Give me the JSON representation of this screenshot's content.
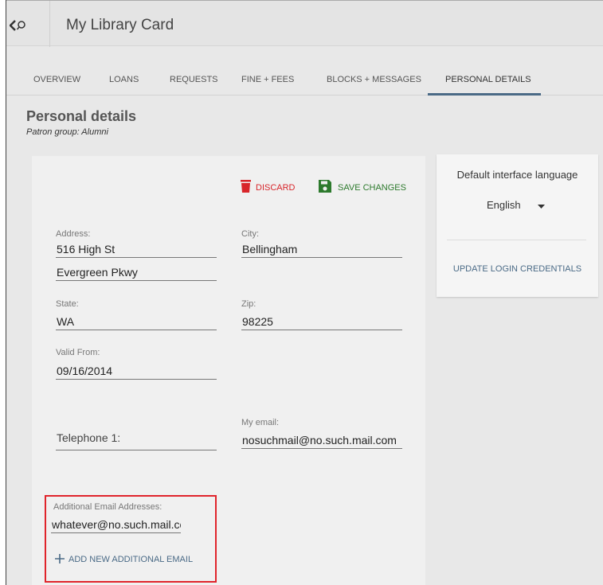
{
  "app": {
    "title": "My Library Card"
  },
  "tabs": [
    {
      "label": "OVERVIEW"
    },
    {
      "label": "LOANS"
    },
    {
      "label": "REQUESTS"
    },
    {
      "label": "FINE + FEES"
    },
    {
      "label": "BLOCKS + MESSAGES"
    },
    {
      "label": "PERSONAL DETAILS",
      "active": true
    }
  ],
  "page": {
    "title": "Personal details",
    "subtitle": "Patron group: Alumni"
  },
  "actions": {
    "discard_label": "DISCARD",
    "save_label": "SAVE CHANGES"
  },
  "fields": {
    "address": {
      "label": "Address:",
      "line1": "516 High St",
      "line2": "Evergreen Pkwy"
    },
    "city": {
      "label": "City:",
      "value": "Bellingham"
    },
    "state": {
      "label": "State:",
      "value": "WA"
    },
    "zip": {
      "label": "Zip:",
      "value": "98225"
    },
    "valid_from": {
      "label": "Valid From:",
      "value": "09/16/2014"
    },
    "telephone": {
      "placeholder": "Telephone 1:"
    },
    "email": {
      "label": "My email:",
      "value": "nosuchmail@no.such.mail.com"
    },
    "additional_email": {
      "label": "Additional Email Addresses:",
      "value": "whatever@no.such.mail.cc",
      "add_label": "ADD NEW ADDITIONAL EMAIL"
    }
  },
  "sidebar": {
    "language_label": "Default interface language",
    "language_value": "English",
    "update_credentials_label": "UPDATE LOGIN CREDENTIALS"
  },
  "colors": {
    "accent": "#4a6a86",
    "discard": "#d8262b",
    "save": "#2d7a2d",
    "highlight": "#e0242b"
  },
  "icons": {
    "nav_toggle": "chevron-left-search-icon",
    "discard": "trash-icon",
    "save": "floppy-disk-icon",
    "add": "plus-icon",
    "dropdown": "caret-down-icon"
  }
}
